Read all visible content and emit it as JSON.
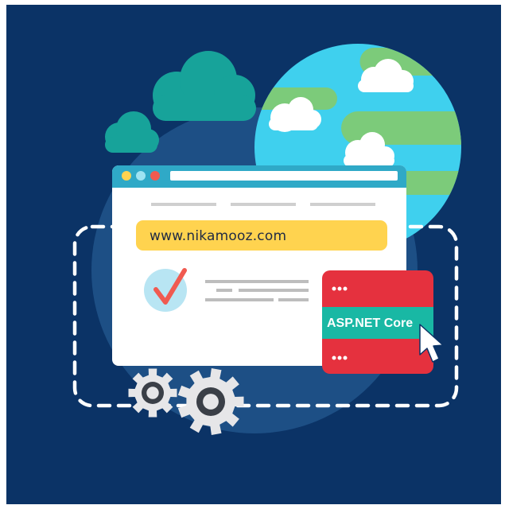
{
  "address_bar": {
    "url": "www.nikamooz.com"
  },
  "badge": {
    "label": "ASP.NET Core"
  },
  "colors": {
    "background": "#0b3366",
    "halo": "#1d4f85",
    "cloud": "#17a39a",
    "globe_water": "#3fd0ee",
    "globe_land": "#7ccb7a",
    "browser_bar": "#2fa9c7",
    "address_bar": "#ffd34f",
    "badge_red": "#e5313e",
    "badge_teal": "#19b8a4",
    "check_red": "#f05a50",
    "check_circle": "#b8e5f3",
    "gear": "#e6e6e8"
  },
  "icons": [
    "cloud-icon",
    "globe-icon",
    "browser-window-icon",
    "checkmark-icon",
    "cursor-icon",
    "gear-icon"
  ]
}
